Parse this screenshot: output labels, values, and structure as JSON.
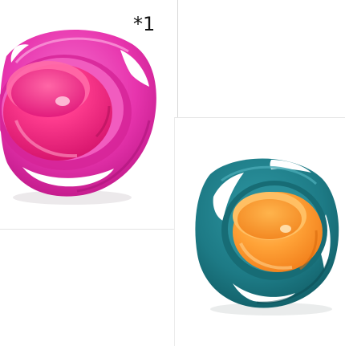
{
  "labels": {
    "count": "*1"
  },
  "products": [
    {
      "name": "pink-gyro-bowl",
      "colors": {
        "ring": "#ef3fb4",
        "ring_dark": "#c41d8a",
        "bowl": "#ff2f8a",
        "bowl_dark": "#d6156b"
      }
    },
    {
      "name": "teal-gyro-bowl",
      "colors": {
        "ring": "#1f7d88",
        "ring_dark": "#13606a",
        "bowl": "#ffa53a",
        "bowl_dark": "#f0801b"
      }
    }
  ]
}
